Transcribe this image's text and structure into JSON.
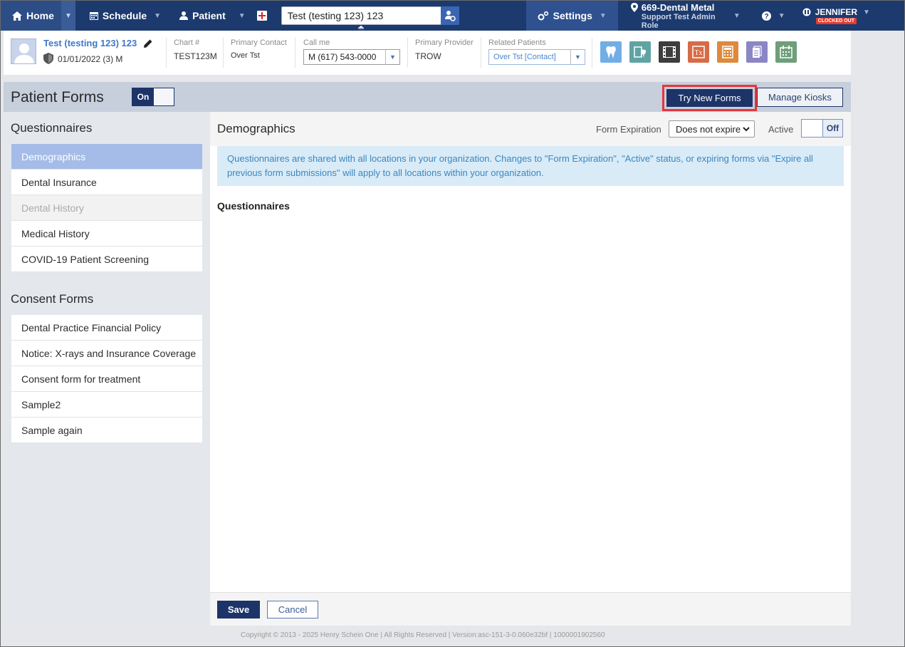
{
  "nav": {
    "home": "Home",
    "schedule": "Schedule",
    "patient": "Patient",
    "search_value": "Test (testing 123) 123",
    "settings": "Settings",
    "location": "669-Dental Metal",
    "role": "Support Test Admin Role",
    "user": "JENNIFER",
    "clock_status": "CLOCKED OUT"
  },
  "patient": {
    "name": "Test (testing 123) 123",
    "dob": "01/01/2022 (3) M",
    "chart_label": "Chart #",
    "chart_value": "TEST123M",
    "primary_contact_label": "Primary Contact",
    "primary_contact_value": "Over Tst",
    "call_me_label": "Call me",
    "call_me_value": "M (617) 543-0000",
    "primary_provider_label": "Primary Provider",
    "primary_provider_value": "TROW",
    "related_patients_label": "Related Patients",
    "related_patients_value": "Over Tst [Contact]",
    "quick_icon_colors": [
      "#72aee6",
      "#5fa3a3",
      "#3d3d3d",
      "#d66b45",
      "#dd8a3c",
      "#8a86c4",
      "#6e9f7a"
    ]
  },
  "forms": {
    "title": "Patient Forms",
    "toggle_on": "On",
    "try_new_forms": "Try New Forms",
    "manage_kiosks": "Manage Kiosks"
  },
  "sidebar": {
    "questionnaires_heading": "Questionnaires",
    "questionnaires": [
      {
        "label": "Demographics"
      },
      {
        "label": "Dental Insurance"
      },
      {
        "label": "Dental History"
      },
      {
        "label": "Medical History"
      },
      {
        "label": "COVID-19 Patient Screening"
      }
    ],
    "consent_heading": "Consent Forms",
    "consent_forms": [
      {
        "label": "Dental Practice Financial Policy"
      },
      {
        "label": "Notice: X-rays and Insurance Coverage"
      },
      {
        "label": "Consent form for treatment"
      },
      {
        "label": "Sample2"
      },
      {
        "label": "Sample again"
      }
    ]
  },
  "main": {
    "title": "Demographics",
    "form_expiration_label": "Form Expiration",
    "form_expiration_value": "Does not expire",
    "active_label": "Active",
    "active_toggle": "Off",
    "info": "Questionnaires are shared with all locations in your organization. Changes to \"Form Expiration\", \"Active\" status, or expiring forms via \"Expire all previous form submissions\" will apply to all locations within your organization.",
    "section_heading": "Questionnaires"
  },
  "footer": {
    "save": "Save",
    "cancel": "Cancel",
    "copyright": "Copyright © 2013 - 2025 Henry Schein One | All Rights Reserved | Version:asc-151-3-0.060e32bf | 1000001902560"
  }
}
